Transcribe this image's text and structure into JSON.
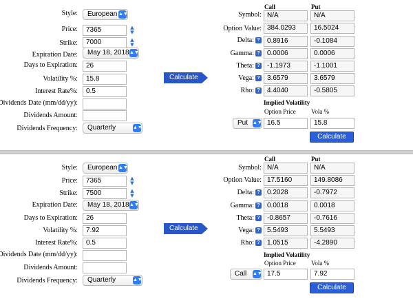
{
  "panels": [
    {
      "inputs": {
        "style": "European",
        "price": "7365",
        "strike": "7000",
        "expiration_date": "May 18, 2018",
        "days_to_expiration": "26",
        "volatility": "15.8",
        "interest_rate": "0.5",
        "dividends_date": "",
        "dividends_amount": "",
        "dividends_frequency": "Quarterly"
      },
      "outputs": {
        "symbol": {
          "call": "N/A",
          "put": "N/A"
        },
        "option_value": {
          "call": "384.0293",
          "put": "16.5024"
        },
        "delta": {
          "call": "0.8916",
          "put": "-0.1084"
        },
        "gamma": {
          "call": "0.0006",
          "put": "0.0006"
        },
        "theta": {
          "call": "-1.1973",
          "put": "-1.1001"
        },
        "vega": {
          "call": "3.6579",
          "put": "3.6579"
        },
        "rho": {
          "call": "4.4040",
          "put": "-0.5805"
        }
      },
      "implied": {
        "type": "Put",
        "option_price": "16.5",
        "vola": "15.8"
      }
    },
    {
      "inputs": {
        "style": "European",
        "price": "7365",
        "strike": "7500",
        "expiration_date": "May 18, 2018",
        "days_to_expiration": "26",
        "volatility": "7.92",
        "interest_rate": "0.5",
        "dividends_date": "",
        "dividends_amount": "",
        "dividends_frequency": "Quarterly"
      },
      "outputs": {
        "symbol": {
          "call": "N/A",
          "put": "N/A"
        },
        "option_value": {
          "call": "17.5160",
          "put": "149.8086"
        },
        "delta": {
          "call": "0.2028",
          "put": "-0.7972"
        },
        "gamma": {
          "call": "0.0018",
          "put": "0.0018"
        },
        "theta": {
          "call": "-0.8657",
          "put": "-0.7616"
        },
        "vega": {
          "call": "5.5493",
          "put": "5.5493"
        },
        "rho": {
          "call": "1.0515",
          "put": "-4.2890"
        }
      },
      "implied": {
        "type": "Call",
        "option_price": "17.5",
        "vola": "7.92"
      }
    }
  ],
  "labels": {
    "style": "Style:",
    "price": "Price:",
    "strike": "Strike:",
    "expiration_date": "Expiration Date:",
    "days_to_expiration": "Days to Expiration:",
    "volatility": "Volatility %:",
    "interest_rate": "Interest Rate%:",
    "dividends_date": "Dividends Date (mm/dd/yy):",
    "dividends_amount": "Dividends Amount:",
    "dividends_frequency": "Dividends Frequency:",
    "call": "Call",
    "put": "Put",
    "symbol": "Symbol:",
    "option_value": "Option Value:",
    "delta": "Delta:",
    "gamma": "Gamma:",
    "theta": "Theta:",
    "vega": "Vega:",
    "rho": "Rho:",
    "implied_volatility": "Implied Volatility",
    "option_price": "Option Price",
    "vola": "Vola %",
    "calculate": "Calculate",
    "help": "?"
  },
  "icons": {
    "select_arrow": "chevron-updown-icon",
    "spinner": "stepper-icon",
    "help": "question-icon"
  },
  "colors": {
    "accent": "#2f7cf6",
    "button": "#2856c7",
    "help": "#2f64c8"
  }
}
